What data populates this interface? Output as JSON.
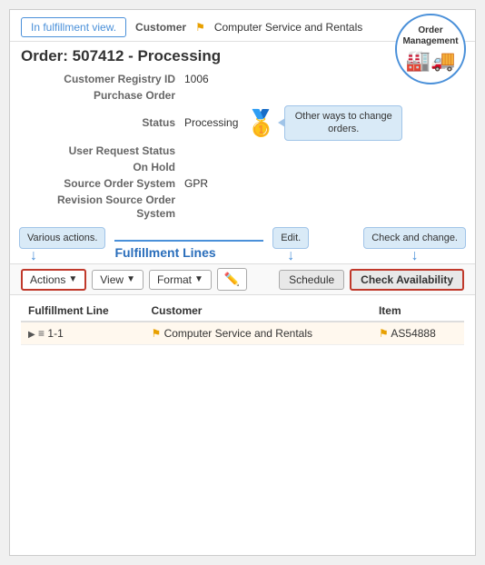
{
  "header": {
    "title": "Order: 507412 - Processing",
    "fulfillment_btn": "In fulfillment view.",
    "customer_label": "Customer",
    "customer_value": "Computer Service and Rentals",
    "badge_title": "Order Management"
  },
  "fields": [
    {
      "label": "Customer Registry ID",
      "value": "1006"
    },
    {
      "label": "Purchase Order",
      "value": ""
    },
    {
      "label": "Status",
      "value": "Processing"
    },
    {
      "label": "User Request Status",
      "value": ""
    },
    {
      "label": "On Hold",
      "value": ""
    },
    {
      "label": "Source Order System",
      "value": "GPR"
    },
    {
      "label": "Revision Source Order System",
      "value": ""
    }
  ],
  "status_callout": "Other ways to change orders.",
  "tab": {
    "title": "Fulfillment Lines"
  },
  "annotations": {
    "various_actions": "Various actions.",
    "edit": "Edit.",
    "check_and_change": "Check and change."
  },
  "toolbar": {
    "actions_btn": "Actions",
    "view_btn": "View",
    "format_btn": "Format",
    "schedule_btn": "Schedule",
    "check_avail_btn": "Check Availability"
  },
  "table": {
    "columns": [
      "Fulfillment Line",
      "Customer",
      "Item"
    ],
    "rows": [
      {
        "line": "1-1",
        "customer": "Computer Service and Rentals",
        "item": "AS54888"
      }
    ]
  }
}
